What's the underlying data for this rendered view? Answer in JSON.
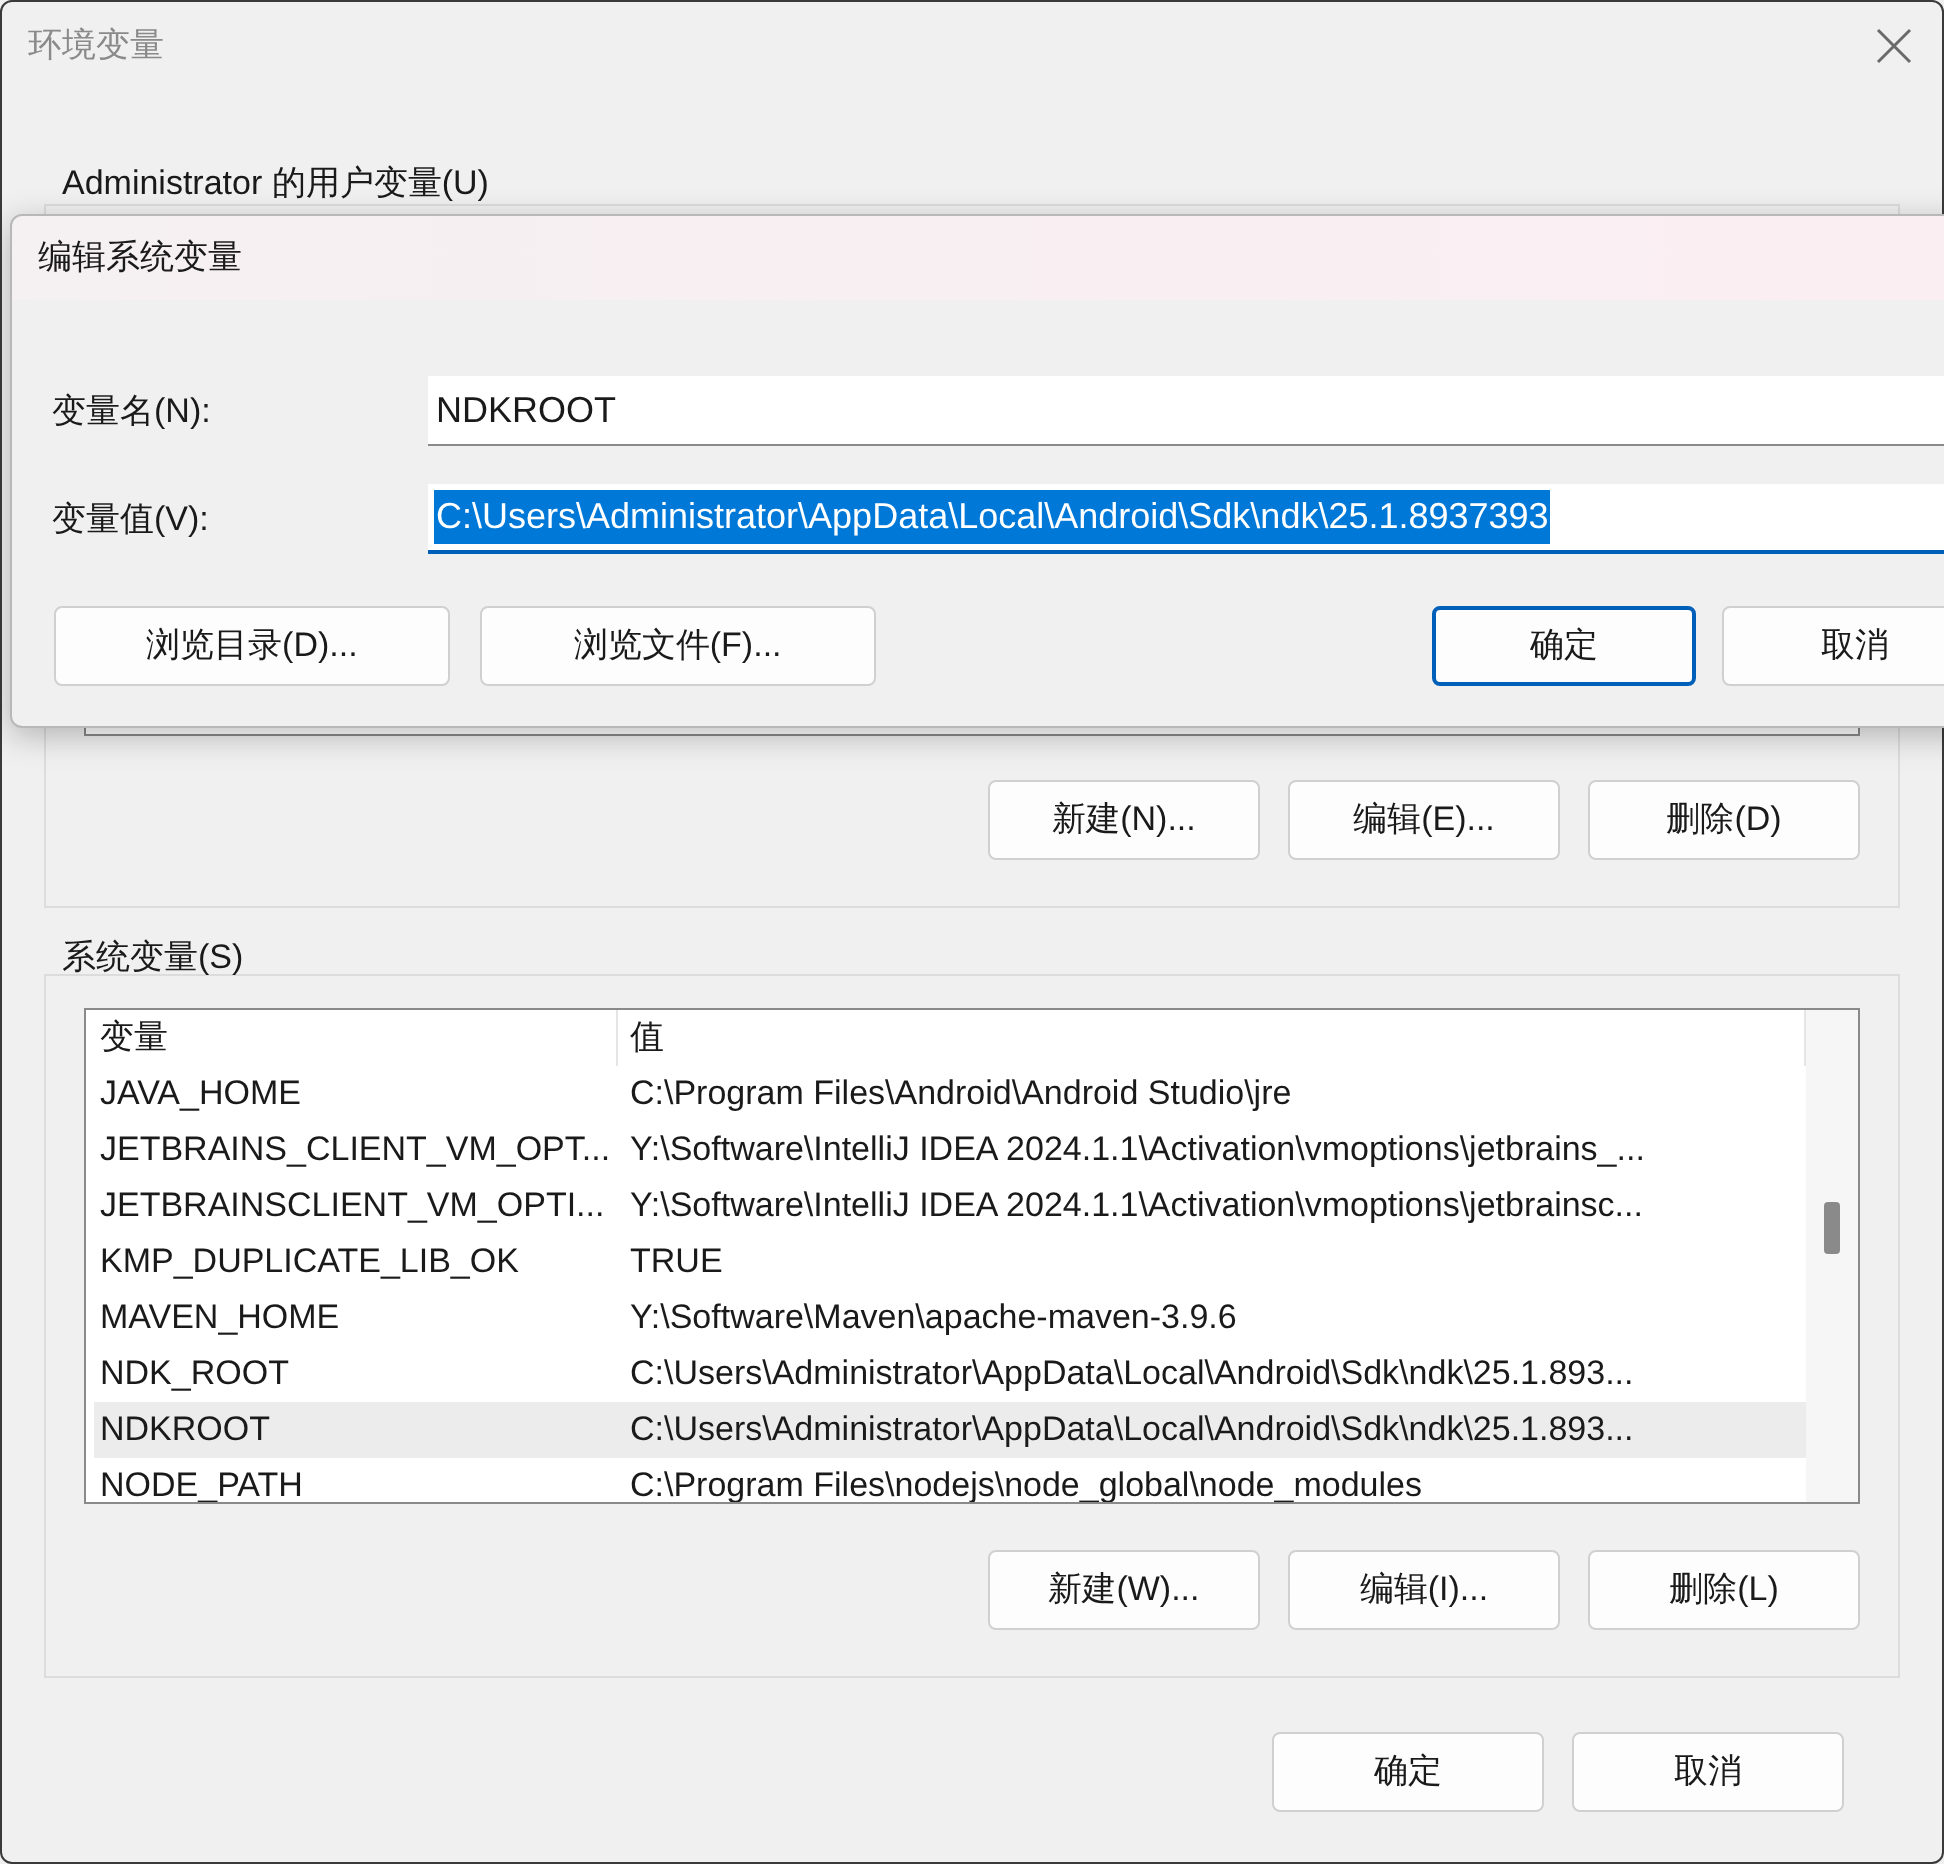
{
  "window": {
    "title": "环境变量"
  },
  "user_variables": {
    "label": "Administrator 的用户变量(U)",
    "buttons": [
      "新建(N)...",
      "编辑(E)...",
      "删除(D)"
    ]
  },
  "system_variables": {
    "label": "系统变量(S)",
    "columns": [
      "变量",
      "值"
    ],
    "rows": [
      {
        "name": "JAVA_HOME",
        "value": "C:\\Program Files\\Android\\Android Studio\\jre",
        "selected": false
      },
      {
        "name": "JETBRAINS_CLIENT_VM_OPT...",
        "value": "Y:\\Software\\IntelliJ IDEA 2024.1.1\\Activation\\vmoptions\\jetbrains_...",
        "selected": false
      },
      {
        "name": "JETBRAINSCLIENT_VM_OPTI...",
        "value": "Y:\\Software\\IntelliJ IDEA 2024.1.1\\Activation\\vmoptions\\jetbrainsc...",
        "selected": false
      },
      {
        "name": "KMP_DUPLICATE_LIB_OK",
        "value": "TRUE",
        "selected": false
      },
      {
        "name": "MAVEN_HOME",
        "value": "Y:\\Software\\Maven\\apache-maven-3.9.6",
        "selected": false
      },
      {
        "name": "NDK_ROOT",
        "value": "C:\\Users\\Administrator\\AppData\\Local\\Android\\Sdk\\ndk\\25.1.893...",
        "selected": false
      },
      {
        "name": "NDKROOT",
        "value": "C:\\Users\\Administrator\\AppData\\Local\\Android\\Sdk\\ndk\\25.1.893...",
        "selected": true
      },
      {
        "name": "NODE_PATH",
        "value": "C:\\Program Files\\nodejs\\node_global\\node_modules",
        "selected": false
      }
    ],
    "buttons": [
      "新建(W)...",
      "编辑(I)...",
      "删除(L)"
    ]
  },
  "footer_buttons": [
    {
      "label": "确定"
    },
    {
      "label": "取消"
    }
  ],
  "edit_dialog": {
    "title": "编辑系统变量",
    "fields": [
      {
        "label": "变量名(N):",
        "value": "NDKROOT",
        "focused": false
      },
      {
        "label": "变量值(V):",
        "value": "C:\\Users\\Administrator\\AppData\\Local\\Android\\Sdk\\ndk\\25.1.8937393",
        "focused": true
      }
    ],
    "buttons": [
      {
        "label": "浏览目录(D)...",
        "default": false
      },
      {
        "label": "浏览文件(F)...",
        "default": false
      },
      {
        "label": "确定",
        "default": true
      },
      {
        "label": "取消",
        "default": false
      }
    ]
  }
}
